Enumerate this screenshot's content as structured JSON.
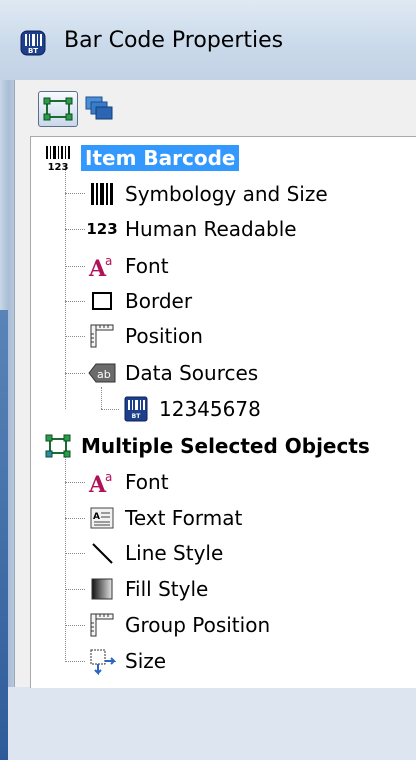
{
  "window": {
    "title": "Bar Code Properties"
  },
  "toolbar": {
    "buttons": [
      "object-properties-icon",
      "multiple-objects-icon"
    ]
  },
  "tree": {
    "item": {
      "label": "Item Barcode",
      "children": [
        {
          "label": "Symbology and Size",
          "icon": "barcode-icon"
        },
        {
          "label": "Human Readable",
          "icon": "human-readable-icon",
          "icon_text": "123"
        },
        {
          "label": "Font",
          "icon": "font-icon"
        },
        {
          "label": "Border",
          "icon": "border-icon"
        },
        {
          "label": "Position",
          "icon": "position-icon"
        },
        {
          "label": "Data Sources",
          "icon": "data-sources-icon"
        }
      ],
      "data_source": {
        "label": "12345678",
        "icon": "data-field-icon"
      }
    },
    "multi": {
      "label": "Multiple Selected Objects",
      "children": [
        {
          "label": "Font",
          "icon": "font-icon"
        },
        {
          "label": "Text Format",
          "icon": "text-format-icon"
        },
        {
          "label": "Line Style",
          "icon": "line-style-icon"
        },
        {
          "label": "Fill Style",
          "icon": "fill-style-icon"
        },
        {
          "label": "Group Position",
          "icon": "position-icon"
        },
        {
          "label": "Size",
          "icon": "size-icon"
        }
      ]
    }
  },
  "colors": {
    "selection": "#3399ff",
    "title_bar": "#c9d9ea"
  }
}
